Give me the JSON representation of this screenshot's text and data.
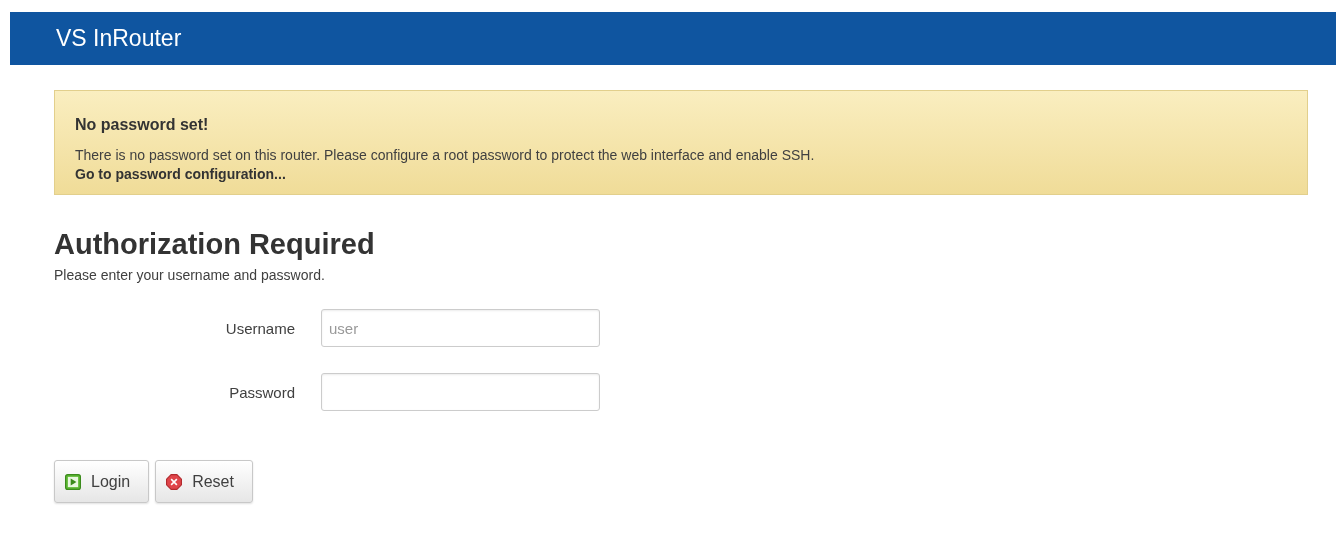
{
  "header": {
    "title": "VS InRouter"
  },
  "alert": {
    "title": "No password set!",
    "message": "There is no password set on this router. Please configure a root password to protect the web interface and enable SSH.",
    "link": "Go to password configuration..."
  },
  "heading": "Authorization Required",
  "intro": "Please enter your username and password.",
  "fields": [
    {
      "label": "Username",
      "placeholder": "user"
    },
    {
      "label": "Password"
    }
  ],
  "buttons": [
    {
      "label": "Login",
      "kind": "play"
    },
    {
      "label": "Reset",
      "kind": "cancel"
    }
  ]
}
